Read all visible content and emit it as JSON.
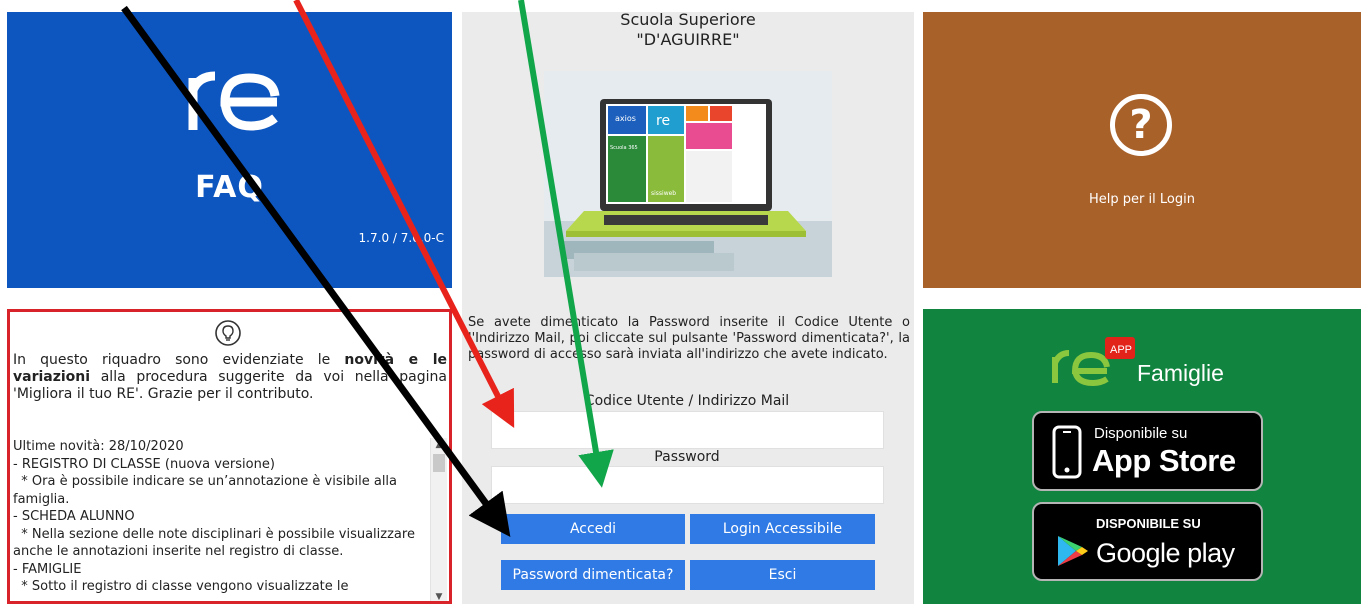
{
  "faq_tile": {
    "title": "FAQ",
    "version": "1.7.0 / 7.0.0-C"
  },
  "school": {
    "name_line1": "Scuola Superiore",
    "name_line2": "\"D'AGUIRRE\""
  },
  "laptop_screen": {
    "tile_axios": "axios",
    "tile_re": "re",
    "tile_scuola": "Scuola 365",
    "tile_sissiweb": "sissiweb"
  },
  "login": {
    "notice": "Se avete dimenticato la Password inserite il Codice Utente o l'Indirizzo Mail, poi cliccate sul pulsante 'Password dimenticata?', la password di accesso sarà inviata all'indirizzo che avete indicato.",
    "user_label": "Codice Utente / Indirizzo Mail",
    "user_value": "",
    "password_label": "Password",
    "password_value": "",
    "btn_login": "Accedi",
    "btn_accessible": "Login Accessibile",
    "btn_forgot": "Password dimenticata?",
    "btn_exit": "Esci"
  },
  "news": {
    "intro_before": "In questo riquadro sono evidenziate le ",
    "intro_bold1": "novità e le variazioni",
    "intro_after": " alla procedura suggerite da voi nella pagina 'Migliora il tuo RE'. Grazie per il contributo.",
    "content": "Ultime novità: 28/10/2020\n- REGISTRO DI CLASSE (nuova versione)\n  * Ora è possibile indicare se un’annotazione è visibile alla famiglia.\n- SCHEDA ALUNNO\n  * Nella sezione delle note disciplinari è possibile visualizzare anche le annotazioni inserite nel registro di classe.\n- FAMIGLIE\n  * Sotto il registro di classe vengono visualizzate le"
  },
  "help_tile": {
    "icon": "?",
    "label": "Help per il Login"
  },
  "app_tile": {
    "logo_re": "re",
    "logo_badge": "APP",
    "logo_text": "Famiglie",
    "appstore_small": "Disponibile su",
    "appstore_big": "App Store",
    "googleplay_small": "DISPONIBILE SU",
    "googleplay_big": "Google play"
  },
  "colors": {
    "faq_blue": "#0d56c0",
    "help_brown": "#a9612a",
    "app_green": "#118440",
    "button_blue": "#2f7ae5",
    "news_border": "#d9232a",
    "arrow_red": "#e8231c",
    "arrow_green": "#12a64a",
    "arrow_black": "#000000"
  }
}
